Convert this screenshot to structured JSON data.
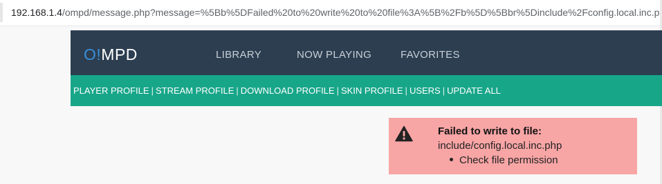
{
  "browser": {
    "url_host": "192.168.1.4",
    "url_rest": "/ompd/message.php?message=%5Bb%5DFailed%20to%20write%20to%20file%3A%5B%2Fb%5D%5Bbr%5Dinclude%2Fconfig.local.inc.php%5"
  },
  "navbar": {
    "logo_o": "O!",
    "logo_rest": "MPD",
    "links": [
      "LIBRARY",
      "NOW PLAYING",
      "FAVORITES"
    ]
  },
  "subnav": {
    "links": [
      "PLAYER PROFILE",
      "STREAM PROFILE",
      "DOWNLOAD PROFILE",
      "SKIN PROFILE",
      "USERS",
      "UPDATE ALL"
    ],
    "separator": "|"
  },
  "alert": {
    "icon": "warning-icon",
    "title": "Failed to write to file:",
    "path": "include/config.local.inc.php",
    "items": [
      "Check file permission"
    ],
    "background": "#f8a5a5"
  },
  "colors": {
    "navbar_bg": "#2c3e50",
    "subnav_bg": "#18a689",
    "logo_accent": "#3a8fd9"
  }
}
